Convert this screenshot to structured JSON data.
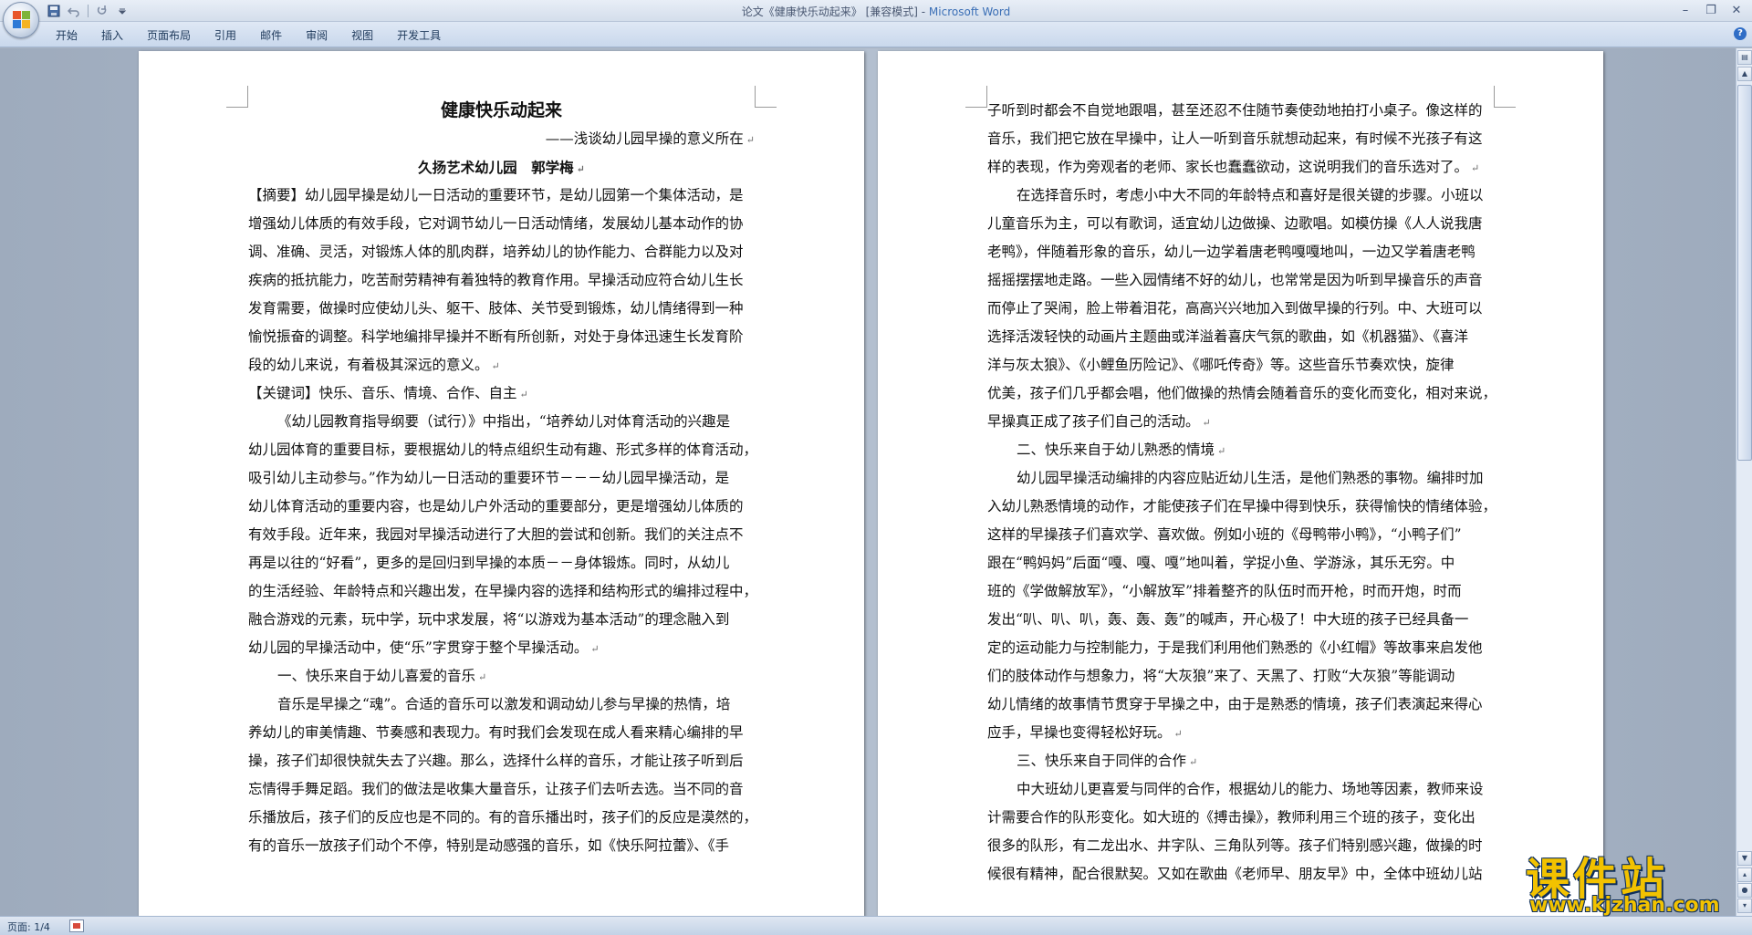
{
  "window": {
    "title_prefix": "论文《健康快乐动起来》 [兼容模式] - ",
    "app_name": "Microsoft Word",
    "minimize": "–",
    "maximize": "❐",
    "close": "✕"
  },
  "ribbon": {
    "tabs": [
      "开始",
      "插入",
      "页面布局",
      "引用",
      "邮件",
      "审阅",
      "视图",
      "开发工具"
    ],
    "help": "?"
  },
  "pages": {
    "left": [
      {
        "text": "健康快乐动起来",
        "style": "title"
      },
      {
        "text": "——浅谈幼儿园早操的意义所在",
        "style": "subtitle",
        "mark": true
      },
      {
        "text": "久扬艺术幼儿园　郭学梅",
        "style": "author",
        "mark": true
      },
      {
        "text": "【摘要】幼儿园早操是幼儿一日活动的重要环节，是幼儿园第一个集体活动，是",
        "style": "plain"
      },
      {
        "text": "增强幼儿体质的有效手段，它对调节幼儿一日活动情绪，发展幼儿基本动作的协",
        "style": "plain"
      },
      {
        "text": "调、准确、灵活，对锻炼人体的肌肉群，培养幼儿的协作能力、合群能力以及对",
        "style": "plain"
      },
      {
        "text": "疾病的抵抗能力，吃苦耐劳精神有着独特的教育作用。早操活动应符合幼儿生长",
        "style": "plain"
      },
      {
        "text": "发育需要，做操时应使幼儿头、躯干、肢体、关节受到锻炼，幼儿情绪得到一种",
        "style": "plain"
      },
      {
        "text": "愉悦振奋的调整。科学地编排早操并不断有所创新，对处于身体迅速生长发育阶",
        "style": "plain"
      },
      {
        "text": "段的幼儿来说，有着极其深远的意义。",
        "style": "plain",
        "mark": true
      },
      {
        "text": "【关键词】快乐、音乐、情境、合作、自主",
        "style": "plain",
        "mark": true
      },
      {
        "text": "《幼儿园教育指导纲要（试行）》中指出，“培养幼儿对体育活动的兴趣是",
        "style": "indent"
      },
      {
        "text": "幼儿园体育的重要目标，要根据幼儿的特点组织生动有趣、形式多样的体育活动，",
        "style": "plain"
      },
      {
        "text": "吸引幼儿主动参与。”作为幼儿一日活动的重要环节－－－幼儿园早操活动，是",
        "style": "plain"
      },
      {
        "text": "幼儿体育活动的重要内容，也是幼儿户外活动的重要部分，更是增强幼儿体质的",
        "style": "plain"
      },
      {
        "text": "有效手段。近年来，我园对早操活动进行了大胆的尝试和创新。我们的关注点不",
        "style": "plain"
      },
      {
        "text": "再是以往的“好看”，更多的是回归到早操的本质－－身体锻炼。同时，从幼儿",
        "style": "plain"
      },
      {
        "text": "的生活经验、年龄特点和兴趣出发，在早操内容的选择和结构形式的编排过程中，",
        "style": "plain"
      },
      {
        "text": "融合游戏的元素，玩中学，玩中求发展，将“以游戏为基本活动”的理念融入到",
        "style": "plain"
      },
      {
        "text": "幼儿园的早操活动中，使“乐”字贯穿于整个早操活动。",
        "style": "plain",
        "mark": true
      },
      {
        "text": "一、快乐来自于幼儿喜爱的音乐",
        "style": "indent",
        "mark": true
      },
      {
        "text": "音乐是早操之“魂”。合适的音乐可以激发和调动幼儿参与早操的热情，培",
        "style": "indent"
      },
      {
        "text": "养幼儿的审美情趣、节奏感和表现力。有时我们会发现在成人看来精心编排的早",
        "style": "plain"
      },
      {
        "text": "操，孩子们却很快就失去了兴趣。那么，选择什么样的音乐，才能让孩子听到后",
        "style": "plain"
      },
      {
        "text": "忘情得手舞足蹈。我们的做法是收集大量音乐，让孩子们去听去选。当不同的音",
        "style": "plain"
      },
      {
        "text": "乐播放后，孩子们的反应也是不同的。有的音乐播出时，孩子们的反应是漠然的，",
        "style": "plain"
      },
      {
        "text": "有的音乐一放孩子们动个不停，特别是动感强的音乐，如《快乐阿拉蕾》、《手",
        "style": "plain"
      }
    ],
    "right": [
      {
        "text": "子听到时都会不自觉地跟唱，甚至还忍不住随节奏使劲地拍打小桌子。像这样的",
        "style": "plain"
      },
      {
        "text": "音乐，我们把它放在早操中，让人一听到音乐就想动起来，有时候不光孩子有这",
        "style": "plain"
      },
      {
        "text": "样的表现，作为旁观者的老师、家长也蠢蠢欲动，这说明我们的音乐选对了。",
        "style": "plain",
        "mark": true
      },
      {
        "text": "在选择音乐时，考虑小中大不同的年龄特点和喜好是很关键的步骤。小班以",
        "style": "indent"
      },
      {
        "text": "儿童音乐为主，可以有歌词，适宜幼儿边做操、边歌唱。如模仿操《人人说我唐",
        "style": "plain"
      },
      {
        "text": "老鸭》，伴随着形象的音乐，幼儿一边学着唐老鸭嘎嘎地叫，一边又学着唐老鸭",
        "style": "plain"
      },
      {
        "text": "摇摇摆摆地走路。一些入园情绪不好的幼儿，也常常是因为听到早操音乐的声音",
        "style": "plain"
      },
      {
        "text": "而停止了哭闹，脸上带着泪花，高高兴兴地加入到做早操的行列。中、大班可以",
        "style": "plain"
      },
      {
        "text": "选择活泼轻快的动画片主题曲或洋溢着喜庆气氛的歌曲，如《机器猫》、《喜洋",
        "style": "plain"
      },
      {
        "text": "洋与灰太狼》、《小鲤鱼历险记》、《哪吒传奇》等。这些音乐节奏欢快，旋律",
        "style": "plain"
      },
      {
        "text": "优美，孩子们几乎都会唱，他们做操的热情会随着音乐的变化而变化，相对来说，",
        "style": "plain"
      },
      {
        "text": "早操真正成了孩子们自己的活动。",
        "style": "plain",
        "mark": true
      },
      {
        "text": "二、快乐来自于幼儿熟悉的情境",
        "style": "indent",
        "mark": true
      },
      {
        "text": "幼儿园早操活动编排的内容应贴近幼儿生活，是他们熟悉的事物。编排时加",
        "style": "indent"
      },
      {
        "text": "入幼儿熟悉情境的动作，才能使孩子们在早操中得到快乐，获得愉快的情绪体验，",
        "style": "plain"
      },
      {
        "text": "这样的早操孩子们喜欢学、喜欢做。例如小班的《母鸭带小鸭》，“小鸭子们”",
        "style": "plain"
      },
      {
        "text": "跟在“鸭妈妈”后面“嘎、嘎、嘎”地叫着，学捉小鱼、学游泳，其乐无穷。中",
        "style": "plain"
      },
      {
        "text": "班的《学做解放军》，“小解放军”排着整齐的队伍时而开枪，时而开炮，时而",
        "style": "plain"
      },
      {
        "text": "发出“叭、叭、叭，轰、轰、轰”的喊声，开心极了！中大班的孩子已经具备一",
        "style": "plain"
      },
      {
        "text": "定的运动能力与控制能力，于是我们利用他们熟悉的《小红帽》等故事来启发他",
        "style": "plain"
      },
      {
        "text": "们的肢体动作与想象力，将“大灰狼”来了、天黑了、打败“大灰狼”等能调动",
        "style": "plain"
      },
      {
        "text": "幼儿情绪的故事情节贯穿于早操之中，由于是熟悉的情境，孩子们表演起来得心",
        "style": "plain"
      },
      {
        "text": "应手，早操也变得轻松好玩。",
        "style": "plain",
        "mark": true
      },
      {
        "text": "三、快乐来自于同伴的合作",
        "style": "indent",
        "mark": true
      },
      {
        "text": "中大班幼儿更喜爱与同伴的合作，根据幼儿的能力、场地等因素，教师来设",
        "style": "indent"
      },
      {
        "text": "计需要合作的队形变化。如大班的《搏击操》，教师利用三个班的孩子，变化出",
        "style": "plain"
      },
      {
        "text": "很多的队形，有二龙出水、井字队、三角队列等。孩子们特别感兴趣，做操的时",
        "style": "plain"
      },
      {
        "text": "候很有精神，配合很默契。又如在歌曲《老师早、朋友早》中，全体中班幼儿站",
        "style": "plain"
      }
    ],
    "paragraph_mark": "↵"
  },
  "statusbar": {
    "page_info": "页面: 1/4"
  },
  "watermark": {
    "title": "课件站",
    "url": "www.kjzhan.com"
  }
}
